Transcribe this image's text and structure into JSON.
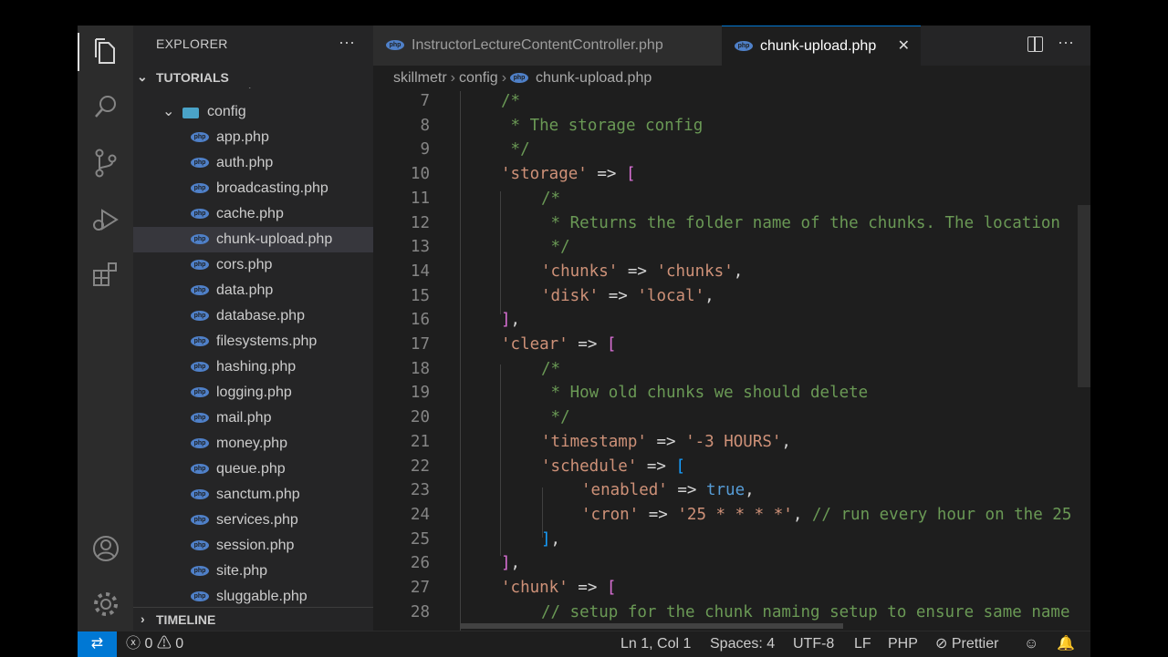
{
  "sidebar": {
    "title": "EXPLORER",
    "more": "···",
    "folder": "TUTORIALS",
    "partial_item": "bootstrap",
    "subfolder": "config",
    "files": [
      "app.php",
      "auth.php",
      "broadcasting.php",
      "cache.php",
      "chunk-upload.php",
      "cors.php",
      "data.php",
      "database.php",
      "filesystems.php",
      "hashing.php",
      "logging.php",
      "mail.php",
      "money.php",
      "queue.php",
      "sanctum.php",
      "services.php",
      "session.php",
      "site.php",
      "sluggable.php"
    ],
    "timeline": "TIMELINE"
  },
  "tabs": [
    {
      "label": "InstructorLectureContentController.php"
    },
    {
      "label": "chunk-upload.php",
      "close": "✕"
    }
  ],
  "tab_more": "···",
  "breadcrumb": [
    "skillmetr",
    "config",
    "chunk-upload.php"
  ],
  "editor": {
    "lines": [
      {
        "n": "7"
      },
      {
        "n": "8"
      },
      {
        "n": "9"
      },
      {
        "n": "10"
      },
      {
        "n": "11"
      },
      {
        "n": "12"
      },
      {
        "n": "13"
      },
      {
        "n": "14"
      },
      {
        "n": "15"
      },
      {
        "n": "16"
      },
      {
        "n": "17"
      },
      {
        "n": "18"
      },
      {
        "n": "19"
      },
      {
        "n": "20"
      },
      {
        "n": "21"
      },
      {
        "n": "22"
      },
      {
        "n": "23"
      },
      {
        "n": "24"
      },
      {
        "n": "25"
      },
      {
        "n": "26"
      },
      {
        "n": "27"
      },
      {
        "n": "28"
      }
    ],
    "tokens": {
      "l7": "/*",
      "l8": " * The storage config",
      "l9": " */",
      "l10_key": "'storage'",
      "arrow": " => ",
      "l12": " * Returns the folder name of the chunks. The location",
      "l14_key": "'chunks'",
      "l14_val": "'chunks'",
      "l15_key": "'disk'",
      "l15_val": "'local'",
      "l17_key": "'clear'",
      "l19": " * How old chunks we should delete",
      "l21_key": "'timestamp'",
      "l21_val": "'-3 HOURS'",
      "l22_key": "'schedule'",
      "l23_key": "'enabled'",
      "l23_val": "true",
      "l24_key": "'cron'",
      "l24_val": "'25 * * * *'",
      "l24_comment": "// run every hour on the 25",
      "l27_key": "'chunk'",
      "l28": "// setup for the chunk naming setup to ensure same name"
    }
  },
  "status": {
    "remote_icon": "remote-icon",
    "errors": "0",
    "warnings": "0",
    "position": "Ln 1, Col 1",
    "spaces": "Spaces: 4",
    "encoding": "UTF-8",
    "eol": "LF",
    "language": "PHP",
    "formatter": "Prettier"
  }
}
